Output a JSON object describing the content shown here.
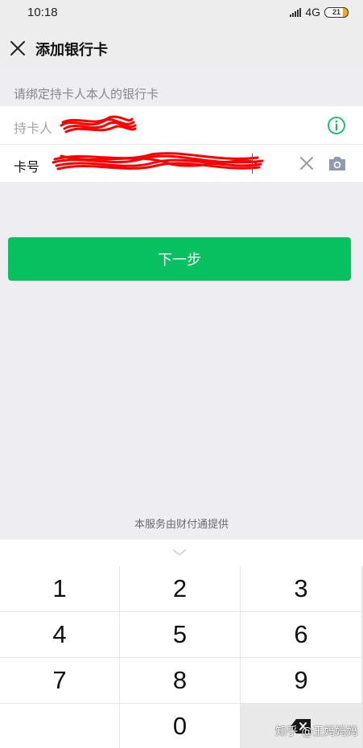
{
  "status_bar": {
    "time": "10:18",
    "network": "4G",
    "battery": "21"
  },
  "nav": {
    "title": "添加银行卡"
  },
  "form": {
    "hint": "请绑定持卡人本人的银行卡",
    "name_label": "持卡人",
    "card_label": "卡号"
  },
  "actions": {
    "next_label": "下一步"
  },
  "footer": {
    "service_note": "本服务由财付通提供"
  },
  "keypad": {
    "keys": [
      "1",
      "2",
      "3",
      "4",
      "5",
      "6",
      "7",
      "8",
      "9",
      "",
      "0"
    ]
  },
  "watermark": {
    "text": "知乎 @王妈妈妈"
  },
  "colors": {
    "accent": "#07C160",
    "scribble": "#FF0000"
  }
}
